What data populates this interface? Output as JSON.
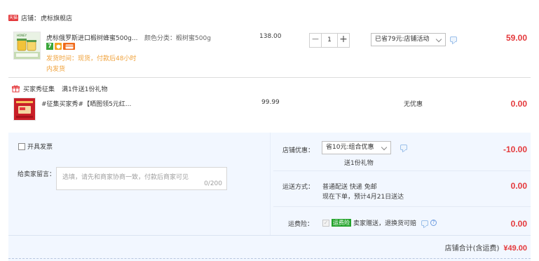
{
  "store": {
    "tag": "天猫",
    "label": "店铺：",
    "name": "虎标旗舰店"
  },
  "item1": {
    "title": "虎标俄罗斯进口椴树蜂蜜500g...",
    "spec_label": "颜色分类：",
    "spec_value": "椴树蜜500g",
    "unit_price": "138.00",
    "quantity": "1",
    "promo_select": "已省79元:店铺活动",
    "ship_time_line1": "发货时间：现货，付款后48小时",
    "ship_time_line2": "内发货",
    "subtotal": "59.00",
    "badge_colors": [
      "#3aa63a",
      "#f5a623",
      "#f06a1a"
    ]
  },
  "gift_section": {
    "title": "买家秀征集",
    "subtitle": "满1件送1份礼物",
    "item_title": "#征集买家秀#【晒图领5元红...",
    "unit_price": "99.99",
    "discount": "无优惠",
    "subtotal": "0.00"
  },
  "bottom": {
    "invoice_label": "开具发票",
    "message_label": "给卖家留言：",
    "message_placeholder": "选填，请先和商家协商一致，付款后商家可见",
    "message_counter": "0/200",
    "store_discount_label": "店铺优惠：",
    "store_discount_select": "省10元:组合优惠",
    "store_discount_note": "送1份礼物",
    "store_discount_value": "-10.00",
    "delivery_label": "运送方式：",
    "delivery_line1": "普通配送 快递 免邮",
    "delivery_line2": "现在下单，预计4月21日送达",
    "delivery_value": "0.00",
    "insurance_label": "运费险：",
    "insurance_badge": "运费险",
    "insurance_text": "卖家赠送，退换货可赔",
    "insurance_value": "0.00",
    "total_label": "店铺合计(含运费)",
    "total_value": "¥49.00"
  }
}
